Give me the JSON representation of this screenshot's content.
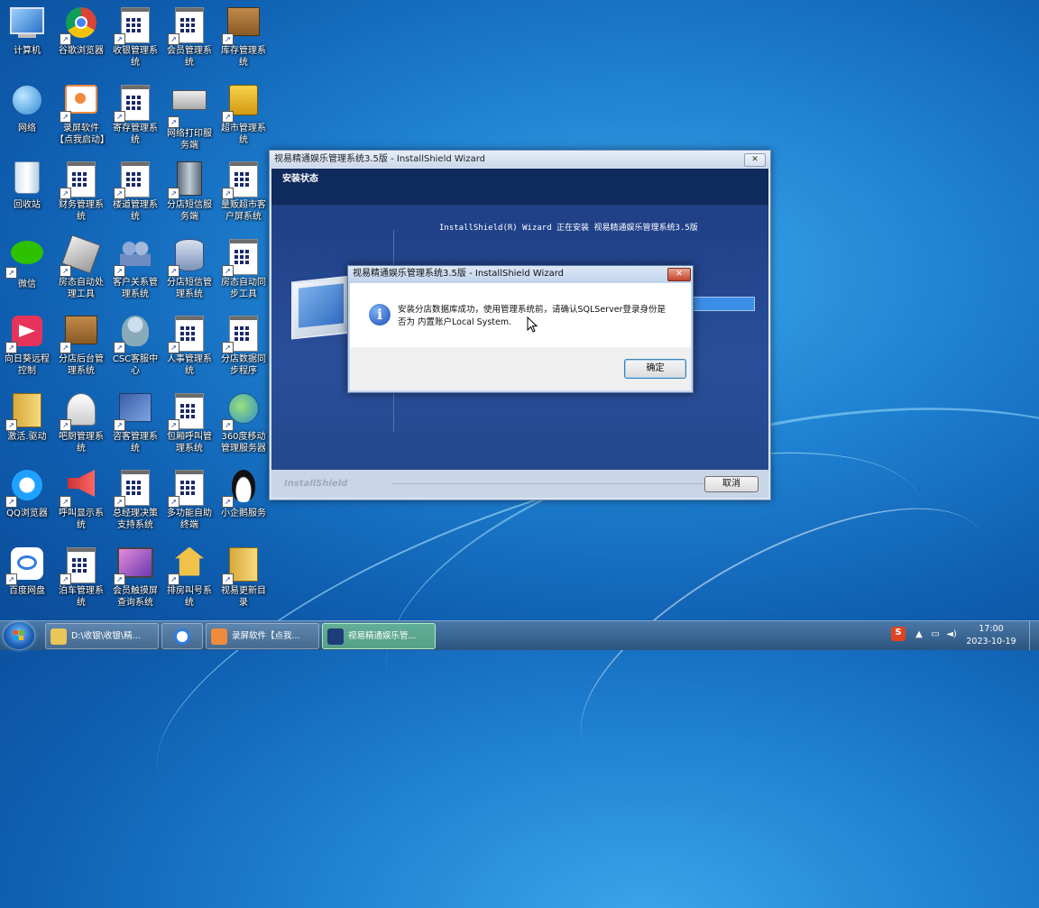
{
  "desktop": {
    "icons": [
      {
        "label": "计算机",
        "kind": "computer"
      },
      {
        "label": "谷歌浏览器",
        "kind": "chrome"
      },
      {
        "label": "收银管理系统",
        "kind": "doc"
      },
      {
        "label": "会员管理系统",
        "kind": "doc"
      },
      {
        "label": "库存管理系统",
        "kind": "box"
      },
      {
        "label": "网络",
        "kind": "network"
      },
      {
        "label": "录屏软件【点我启动】",
        "kind": "recorder"
      },
      {
        "label": "寄存管理系统",
        "kind": "doc"
      },
      {
        "label": "网络打印服务端",
        "kind": "printer"
      },
      {
        "label": "超市管理系统",
        "kind": "basket"
      },
      {
        "label": "回收站",
        "kind": "recycle"
      },
      {
        "label": "财务管理系统",
        "kind": "doc"
      },
      {
        "label": "楼道管理系统",
        "kind": "doc"
      },
      {
        "label": "分店短信服务端",
        "kind": "server"
      },
      {
        "label": "量贩超市客户屏系统",
        "kind": "doc"
      },
      {
        "label": "微信",
        "kind": "wechat"
      },
      {
        "label": "房态自动处理工具",
        "kind": "tool"
      },
      {
        "label": "客户关系管理系统",
        "kind": "people"
      },
      {
        "label": "分店短信管理系统",
        "kind": "db"
      },
      {
        "label": "房态自动同步工具",
        "kind": "doc"
      },
      {
        "label": "向日葵远程控制",
        "kind": "sunflower"
      },
      {
        "label": "分店后台管理系统",
        "kind": "box"
      },
      {
        "label": "CSC客服中心",
        "kind": "csc"
      },
      {
        "label": "人事管理系统",
        "kind": "doc"
      },
      {
        "label": "分店数据同步程序",
        "kind": "doc"
      },
      {
        "label": "激活.驱动",
        "kind": "folder"
      },
      {
        "label": "吧厨管理系统",
        "kind": "chef"
      },
      {
        "label": "咨客管理系统",
        "kind": "chart"
      },
      {
        "label": "包厢呼叫管理系统",
        "kind": "doc"
      },
      {
        "label": "360度移动管理服务器",
        "kind": "globe"
      },
      {
        "label": "QQ浏览器",
        "kind": "qqbrowser"
      },
      {
        "label": "呼叫显示系统",
        "kind": "speaker"
      },
      {
        "label": "总经理决策支持系统",
        "kind": "doc"
      },
      {
        "label": "多功能自助终端",
        "kind": "doc"
      },
      {
        "label": "小企鹅服务",
        "kind": "penguin"
      },
      {
        "label": "百度网盘",
        "kind": "baidu"
      },
      {
        "label": "泊车管理系统",
        "kind": "doc"
      },
      {
        "label": "会员触摸屏查询系统",
        "kind": "screen"
      },
      {
        "label": "排房叫号系统",
        "kind": "house"
      },
      {
        "label": "视易更新目录",
        "kind": "folder"
      }
    ]
  },
  "installer": {
    "title": "视易精通娱乐管理系统3.5版 - InstallShield Wizard",
    "header": "安装状态",
    "status": "InstallShield(R) Wizard 正在安装 视易精通娱乐管理系统3.5版",
    "brand": "InstallShield",
    "cancel_label": "取消",
    "close_glyph": "✕"
  },
  "dialog": {
    "title": "视易精通娱乐管理系统3.5版 - InstallShield Wizard",
    "message_line1": "安装分店数据库成功，使用管理系统前，请确认SQLServer登录身份是",
    "message_line2": "否为 内置账户Local System.",
    "ok_label": "确定",
    "close_glyph": "✕"
  },
  "taskbar": {
    "items": [
      {
        "label": "D:\\收银\\收银\\精...",
        "icon": "folder"
      },
      {
        "label": "",
        "icon": "baidu"
      },
      {
        "label": "录屏软件【点我...",
        "icon": "recorder"
      },
      {
        "label": "视易精通娱乐管...",
        "icon": "installer",
        "active": true
      }
    ],
    "time": "17:00",
    "date": "2023-10-19"
  },
  "colors": {
    "accent": "#1e7fd0",
    "installer_header": "#0f2a5c",
    "progress": "#3b8ee8"
  }
}
